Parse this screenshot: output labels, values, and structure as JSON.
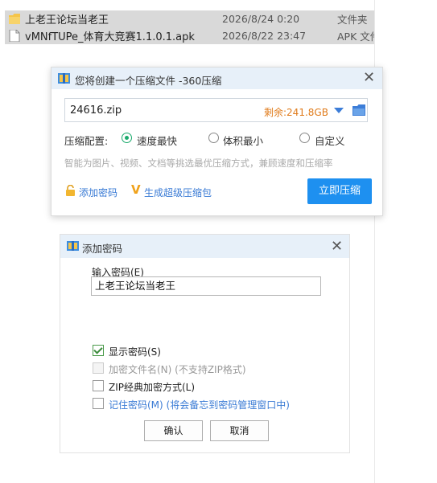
{
  "explorer": {
    "files": [
      {
        "name": "上老王论坛当老王",
        "date": "2026/8/24 0:20",
        "type": "文件夹",
        "icon": "folder-icon"
      },
      {
        "name": "vMNfTUPe_体育大竞赛1.1.0.1.apk",
        "date": "2026/8/22 23:47",
        "type": "APK 文件",
        "icon": "file-icon"
      }
    ]
  },
  "zip_dialog": {
    "title": "您将创建一个压缩文件 -360压缩",
    "filename": "24616.zip",
    "remaining": "剩余:241.8GB",
    "config_label": "压缩配置:",
    "options": [
      "速度最快",
      "体积最小",
      "自定义"
    ],
    "selected_option": "速度最快",
    "hint": "智能为图片、视频、文档等挑选最优压缩方式，兼顾速度和压缩率",
    "add_password": "添加密码",
    "make_super": "生成超级压缩包",
    "compress_now": "立即压缩",
    "colors": {
      "accent": "#1e90f0",
      "remaining": "#e07b1b",
      "link": "#3a7bd5"
    }
  },
  "password_dialog": {
    "title": "添加密码",
    "input_label": "输入密码(E)",
    "password_value": "上老王论坛当老王",
    "checkboxes": [
      {
        "label": "显示密码(S)",
        "checked": true,
        "enabled": true
      },
      {
        "label": "加密文件名(N) (不支持ZIP格式)",
        "checked": false,
        "enabled": false
      },
      {
        "label": "ZIP经典加密方式(L)",
        "checked": false,
        "enabled": true
      },
      {
        "label": "记住密码(M) (将会备忘到密码管理窗口中)",
        "checked": false,
        "enabled": true
      }
    ],
    "ok": "确认",
    "cancel": "取消"
  }
}
